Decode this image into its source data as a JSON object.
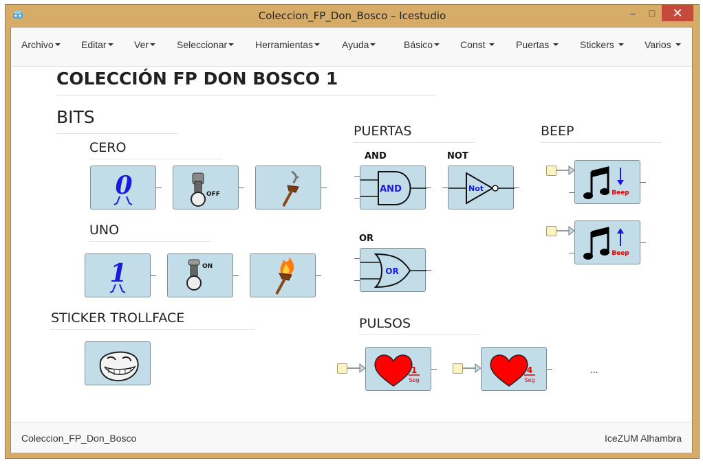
{
  "window": {
    "title": "Coleccion_FP_Don_Bosco – Icestudio",
    "minimize": "–",
    "maximize": "□",
    "close": "✕"
  },
  "menu": {
    "items": [
      "Archivo",
      "Editar",
      "Ver",
      "Seleccionar",
      "Herramientas",
      "Ayuda",
      "Básico",
      "Const ",
      "Puertas ",
      "Stickers ",
      "Varios "
    ]
  },
  "canvas": {
    "title": "COLECCIÓN FP DON BOSCO 1",
    "bits": "BITS",
    "cero": "CERO",
    "uno": "UNO",
    "sticker": "STICKER TROLLFACE",
    "puertas": "PUERTAS",
    "and_label": "AND",
    "not_label": "NOT",
    "or_label": "OR",
    "beep": "BEEP",
    "pulsos": "PULSOS",
    "ellipsis": "...",
    "blocks": {
      "zero": "0",
      "off": "OFF",
      "one": "1",
      "on": "ON",
      "and": "AND",
      "not": "Not",
      "or": "OR",
      "beep_down": "Beep",
      "beep_up": "Beep",
      "pulse1_num": "1",
      "pulse1_unit": "Seg",
      "pulse4_num": "4",
      "pulse4_unit": "Seg"
    }
  },
  "footer": {
    "left": "Coleccion_FP_Don_Bosco",
    "right": "IceZUM Alhambra"
  },
  "colors": {
    "frame": "#d7ab68",
    "block": "#c3dde8",
    "close": "#c7493c",
    "blue": "#1a1adc",
    "red": "#e00000"
  },
  "icons": [
    "app-icon",
    "light-off-icon",
    "light-on-icon",
    "switch-off-icon",
    "switch-on-icon",
    "torch-off-icon",
    "torch-on-icon",
    "music-note-icon",
    "heart-icon",
    "trollface-icon"
  ]
}
